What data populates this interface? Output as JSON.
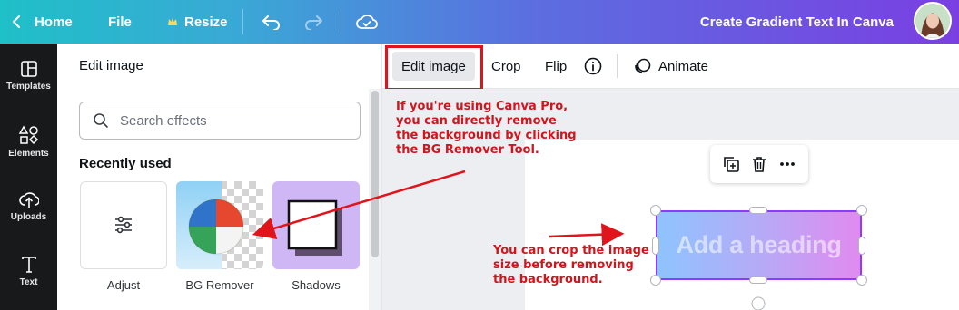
{
  "topbar": {
    "home_label": "Home",
    "file_label": "File",
    "resize_label": "Resize",
    "doc_title": "Create Gradient Text In Canva"
  },
  "rail": {
    "items": [
      {
        "label": "Templates",
        "icon": "templates-icon"
      },
      {
        "label": "Elements",
        "icon": "elements-icon"
      },
      {
        "label": "Uploads",
        "icon": "uploads-icon"
      },
      {
        "label": "Text",
        "icon": "text-icon"
      }
    ]
  },
  "panel": {
    "title": "Edit image",
    "search_placeholder": "Search effects",
    "recently_used": "Recently used",
    "tiles": [
      {
        "label": "Adjust"
      },
      {
        "label": "BG Remover"
      },
      {
        "label": "Shadows"
      }
    ]
  },
  "context_toolbar": {
    "edit_image": "Edit image",
    "crop": "Crop",
    "flip": "Flip",
    "animate": "Animate"
  },
  "canvas": {
    "heading_text": "Add a heading"
  },
  "annotations": {
    "bg_remover_note": [
      "If you're using Canva Pro,",
      "you can directly remove",
      "the background by clicking",
      "the BG Remover Tool."
    ],
    "crop_note": [
      "You can crop the image",
      "size before removing",
      "the background."
    ]
  },
  "colors": {
    "annotation_red": "#e0141b",
    "selection_purple": "#8b3dff",
    "rail_bg": "#18191b"
  }
}
